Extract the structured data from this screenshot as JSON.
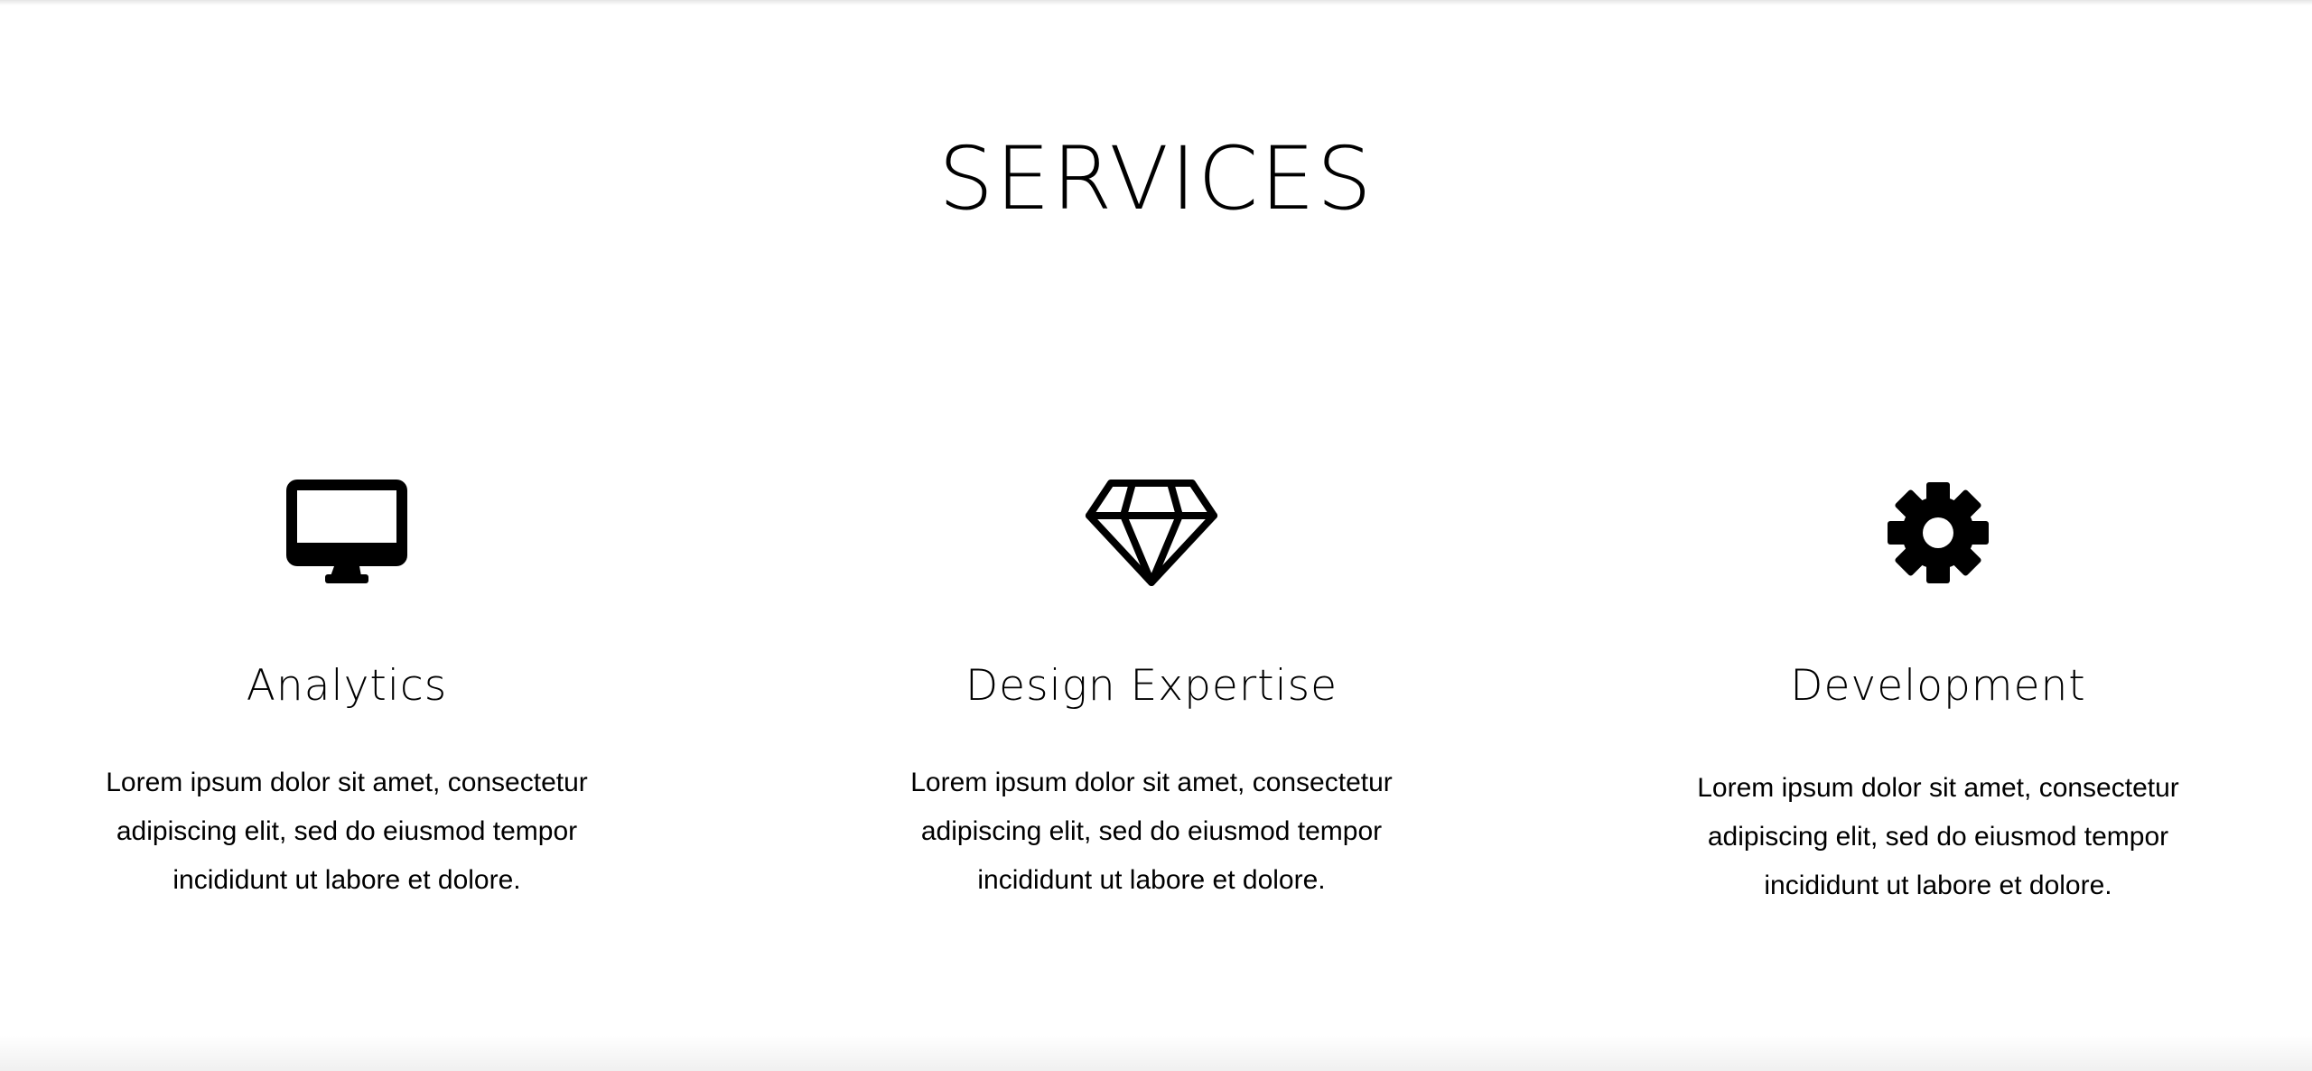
{
  "section": {
    "title": "SERVICES"
  },
  "services": [
    {
      "icon": "monitor-icon",
      "title": "Analytics",
      "description": "Lorem ipsum dolor sit amet, consectetur adipiscing elit, sed do eiusmod tempor incididunt ut labore et dolore."
    },
    {
      "icon": "diamond-icon",
      "title": "Design Expertise",
      "description": "Lorem ipsum dolor sit amet, consectetur adipiscing elit, sed do eiusmod tempor incididunt ut labore et dolore."
    },
    {
      "icon": "gear-icon",
      "title": "Development",
      "description": "Lorem ipsum dolor sit amet, consectetur adipiscing elit, sed do eiusmod tempor incididunt ut labore et dolore."
    }
  ],
  "colors": {
    "background": "#ffffff",
    "text": "#000000"
  }
}
